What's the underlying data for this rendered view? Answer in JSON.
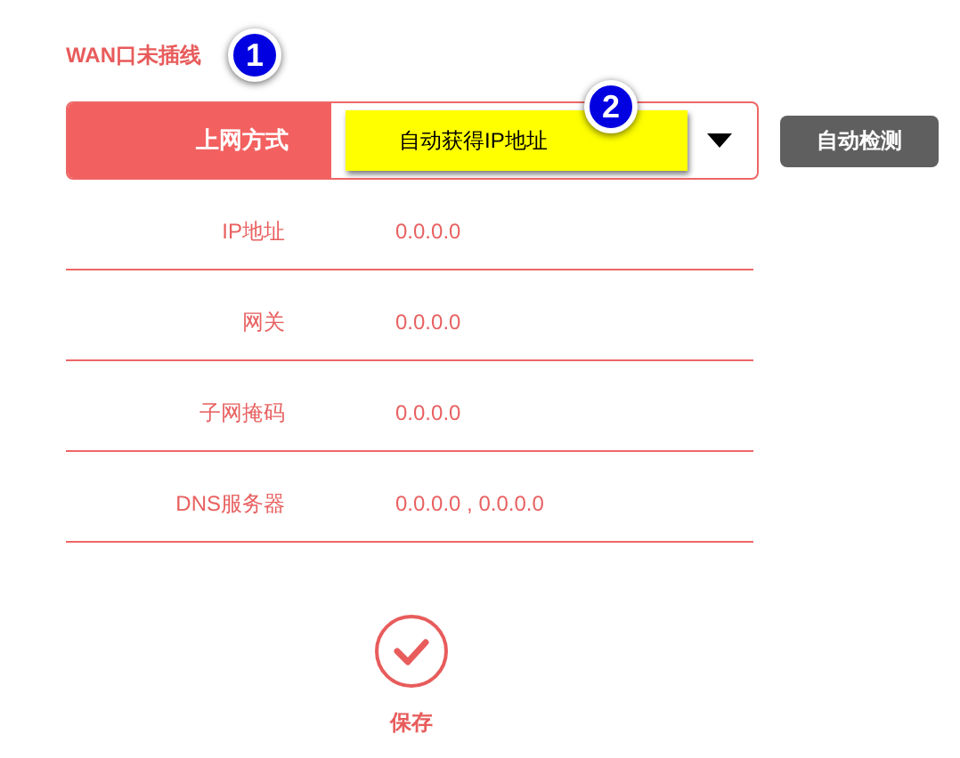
{
  "status": {
    "text": "WAN口未插线"
  },
  "annotations": [
    {
      "text": "1"
    },
    {
      "text": "2"
    }
  ],
  "connection": {
    "label": "上网方式",
    "value": "自动获得IP地址",
    "highlighted": true,
    "detect_button": "自动检测"
  },
  "fields": [
    {
      "label": "IP地址",
      "value": "0.0.0.0"
    },
    {
      "label": "网关",
      "value": "0.0.0.0"
    },
    {
      "label": "子网掩码",
      "value": "0.0.0.0"
    },
    {
      "label": "DNS服务器",
      "value": "0.0.0.0 , 0.0.0.0"
    }
  ],
  "save": {
    "label": "保存"
  }
}
